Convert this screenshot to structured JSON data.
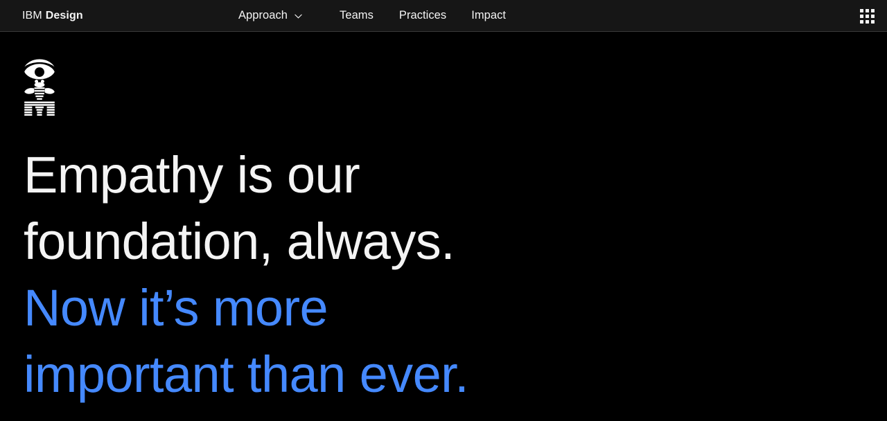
{
  "header": {
    "brand": {
      "prefix": "IBM",
      "suffix": "Design"
    },
    "nav_items": [
      {
        "label": "Approach",
        "icon": "chevron-down-icon",
        "has_dropdown": true
      },
      {
        "label": "Teams",
        "has_dropdown": false
      },
      {
        "label": "Practices",
        "has_dropdown": false
      },
      {
        "label": "Impact",
        "has_dropdown": false
      }
    ],
    "app_switcher": {
      "icon": "grid-nine-dots-icon",
      "dot_count": 9
    },
    "background_color": "#161616",
    "border_color": "#393939"
  },
  "hero": {
    "logo": {
      "name": "eye-bee-m-rebus-logo",
      "description": "IBM Eye-Bee-M rebus: eye, bee, letter M",
      "color": "#ffffff"
    },
    "headline_lines": [
      {
        "text": "Empathy is our",
        "color": "#f4f4f4",
        "accent": false
      },
      {
        "text": "foundation, always.",
        "color": "#f4f4f4",
        "accent": false
      },
      {
        "text": "Now it’s more",
        "color": "#4589ff",
        "accent": true
      },
      {
        "text": "important than ever.",
        "color": "#4589ff",
        "accent": true
      }
    ]
  },
  "theme": {
    "page_background": "#000000",
    "text_primary": "#f4f4f4",
    "accent_blue": "#4589ff"
  }
}
